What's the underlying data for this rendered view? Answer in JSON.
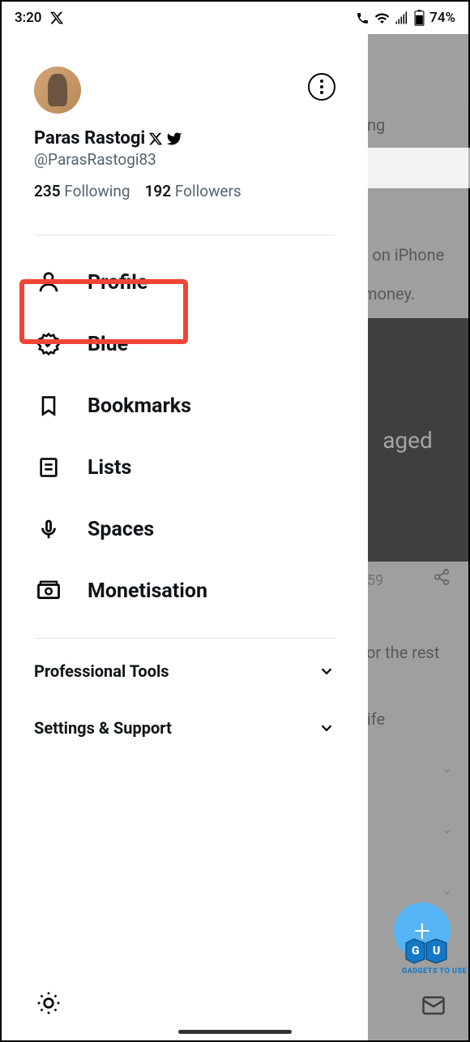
{
  "status_bar": {
    "time": "3:20",
    "battery_text": "74%"
  },
  "profile": {
    "display_name": "Paras Rastogi",
    "handle": "@ParasRastogi83",
    "following_count": "235",
    "following_label": "Following",
    "followers_count": "192",
    "followers_label": "Followers"
  },
  "menu": {
    "profile": "Profile",
    "blue": "Blue",
    "bookmarks": "Bookmarks",
    "lists": "Lists",
    "spaces": "Spaces",
    "monetisation": "Monetisation"
  },
  "sections": {
    "professional_tools": "Professional Tools",
    "settings_support": "Settings & Support"
  },
  "backdrop": {
    "tab_label": "ng",
    "text1": "o on iPhone",
    "text2": "money.",
    "media_label": "aged",
    "count": "59",
    "text3": "for the rest",
    "text4": "life",
    "fab": "+"
  },
  "watermark": {
    "text": "GADGETS TO USE"
  }
}
